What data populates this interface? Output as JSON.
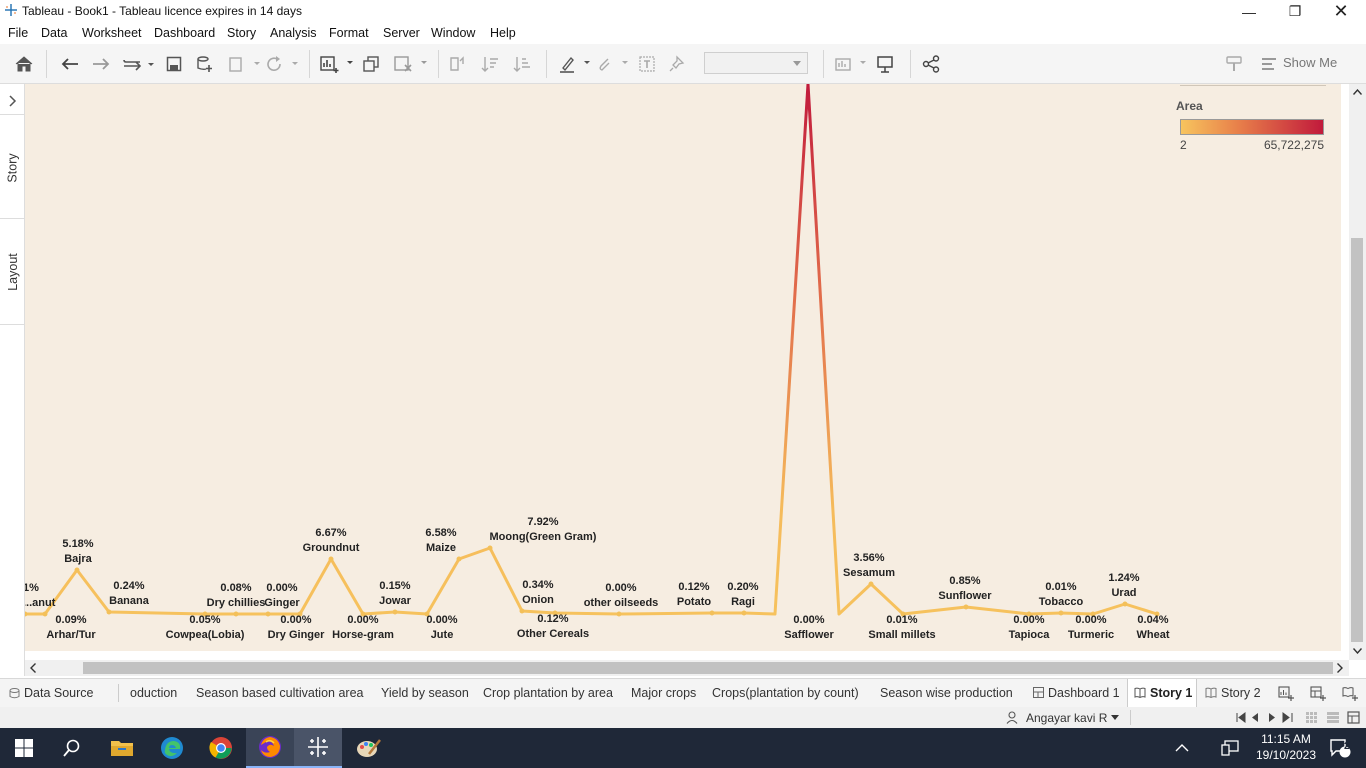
{
  "window": {
    "title": "Tableau - Book1 - Tableau licence expires in 14 days"
  },
  "menu": [
    "File",
    "Data",
    "Worksheet",
    "Dashboard",
    "Story",
    "Analysis",
    "Format",
    "Server",
    "Window",
    "Help"
  ],
  "toolbar": {
    "show_me": "Show Me"
  },
  "side_tabs": {
    "story": "Story",
    "layout": "Layout"
  },
  "legend": {
    "title": "Area",
    "min_label": "2",
    "max_label": "65,722,275",
    "color_low": "#f7c45e",
    "color_high": "#c11a3c"
  },
  "sheet_tabs": [
    "Data Source",
    "oduction",
    "Season based cultivation area",
    "Yield by season",
    "Crop plantation by area",
    "Major crops",
    "Crops(plantation by count)",
    "Season wise production",
    "Dashboard 1",
    "Story 1",
    "Story 2"
  ],
  "status": {
    "user": "Angayar kavi R"
  },
  "clock": {
    "time": "11:15 AM",
    "date": "19/10/2023",
    "notifications": "2"
  },
  "chart_data": {
    "type": "line",
    "color_legend": "Area",
    "points": [
      {
        "x": "...anut",
        "label": "1%"
      },
      {
        "x": "Arhar/Tur",
        "label": "0.09%"
      },
      {
        "x": "Bajra",
        "label": "5.18%"
      },
      {
        "x": "Banana",
        "label": "0.24%"
      },
      {
        "x": "Cowpea(Lobia)",
        "label": "0.05%"
      },
      {
        "x": "Dry chillies",
        "label": "0.08%"
      },
      {
        "x": "Dry Ginger",
        "label": "0.00%"
      },
      {
        "x": "Ginger",
        "label": "0.00%"
      },
      {
        "x": "Groundnut",
        "label": "6.67%"
      },
      {
        "x": "Horse-gram",
        "label": "0.00%"
      },
      {
        "x": "Jowar",
        "label": "0.15%"
      },
      {
        "x": "Jute",
        "label": "0.00%"
      },
      {
        "x": "Maize",
        "label": "6.58%"
      },
      {
        "x": "Moong(Green Gram)",
        "label": "7.92%"
      },
      {
        "x": "Onion",
        "label": "0.34%"
      },
      {
        "x": "Other Cereals",
        "label": "0.12%"
      },
      {
        "x": "other oilseeds",
        "label": "0.00%"
      },
      {
        "x": "Potato",
        "label": "0.12%"
      },
      {
        "x": "Ragi",
        "label": "0.20%"
      },
      {
        "x": "Safflower",
        "label": "0.00%"
      },
      {
        "x": "Sesamum",
        "label": "3.56%"
      },
      {
        "x": "Small millets",
        "label": "0.01%"
      },
      {
        "x": "Sunflower",
        "label": "0.85%"
      },
      {
        "x": "Tapioca",
        "label": "0.00%"
      },
      {
        "x": "Tobacco",
        "label": "0.01%"
      },
      {
        "x": "Turmeric",
        "label": "0.00%"
      },
      {
        "x": "Urad",
        "label": "1.24%"
      },
      {
        "x": "Wheat",
        "label": "0.04%"
      }
    ]
  }
}
